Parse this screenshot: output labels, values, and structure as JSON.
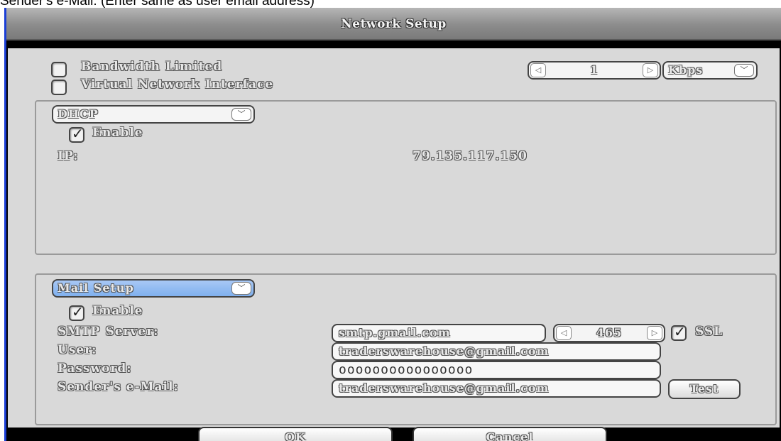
{
  "caption": "Sender's e-Mail: (Enter same as user email address)",
  "window": {
    "title": "Network Setup"
  },
  "bandwidth": {
    "limited_label": "Bandwidth Limited",
    "limited_checked": false,
    "virtual_label": "Virtual Network Interface",
    "virtual_checked": false,
    "value": "1",
    "unit": "Kbps"
  },
  "network": {
    "mode": "DHCP",
    "enable_label": "Enable",
    "enable_checked": true,
    "ip_label": "IP:",
    "ip_value": "79.135.117.150"
  },
  "mail": {
    "section": "Mail Setup",
    "enable_label": "Enable",
    "enable_checked": true,
    "smtp_label": "SMTP Server:",
    "smtp_value": "smtp.gmail.com",
    "port_value": "465",
    "ssl_label": "SSL",
    "ssl_checked": true,
    "user_label": "User:",
    "user_value": "traderswarehouse@gmail.com",
    "password_label": "Password:",
    "password_value": "oooooooooooooooo",
    "sender_label": "Sender's e-Mail:",
    "sender_value": "traderswarehouse@gmail.com",
    "test_label": "Test"
  },
  "buttons": {
    "ok": "OK",
    "cancel": "Cancel"
  },
  "icons": {
    "arrow_left": "spinner-left-icon",
    "arrow_right": "spinner-right-icon",
    "chevron_down": "chevron-down-icon",
    "check": "checkmark-icon"
  }
}
